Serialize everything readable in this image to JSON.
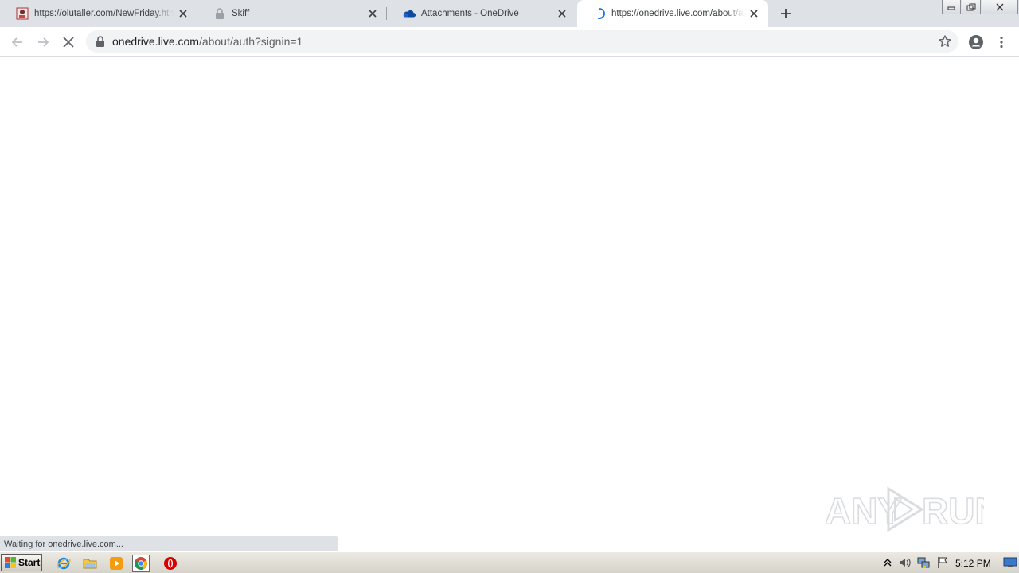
{
  "browser": {
    "tabs": [
      {
        "title": "https://olutaller.com/NewFriday.html",
        "favicon": "site-favicon",
        "active": false
      },
      {
        "title": "Skiff",
        "favicon": "lock-icon",
        "active": false
      },
      {
        "title": "Attachments - OneDrive",
        "favicon": "onedrive-icon",
        "active": false
      },
      {
        "title": "https://onedrive.live.com/about/auth?signin=1",
        "favicon": "loading-spinner-icon",
        "active": true
      }
    ],
    "address": {
      "host": "onedrive.live.com",
      "path": "/about/auth?signin=1"
    },
    "status_text": "Waiting for onedrive.live.com..."
  },
  "watermark": {
    "left": "ANY",
    "right": "RUN"
  },
  "taskbar": {
    "start_label": "Start",
    "clock": "5:12 PM"
  },
  "colors": {
    "tabstrip_bg": "#dee1e6",
    "omnibox_bg": "#f1f3f4",
    "onedrive_blue": "#0f4ca1"
  }
}
